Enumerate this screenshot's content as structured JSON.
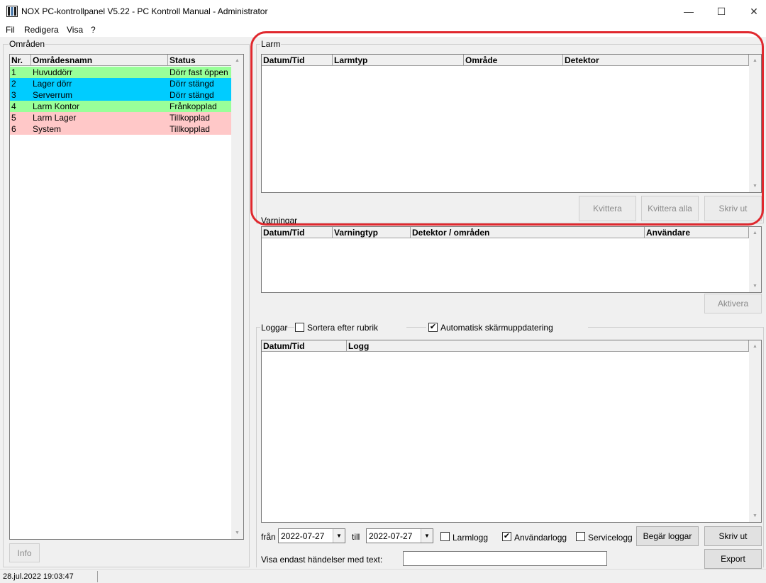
{
  "window": {
    "title": "NOX PC-kontrollpanel V5.22 - PC Kontroll Manual - Administrator",
    "minimize": "—",
    "maximize": "☐",
    "close": "✕"
  },
  "menu": [
    "Fil",
    "Redigera",
    "Visa",
    "?"
  ],
  "areas": {
    "label": "Områden",
    "columns": [
      "Nr.",
      "Områdesnamn",
      "Status"
    ],
    "rows": [
      {
        "nr": "1",
        "name": "Huvuddörr",
        "status": "Dörr fast öppen",
        "color": "#99ff99"
      },
      {
        "nr": "2",
        "name": "Lager dörr",
        "status": "Dörr stängd",
        "color": "#00ccff"
      },
      {
        "nr": "3",
        "name": "Serverrum",
        "status": "Dörr stängd",
        "color": "#00ccff"
      },
      {
        "nr": "4",
        "name": "Larm Kontor",
        "status": "Frånkopplad",
        "color": "#99ff99"
      },
      {
        "nr": "5",
        "name": "Larm Lager",
        "status": "Tillkopplad",
        "color": "#ffc8c8"
      },
      {
        "nr": "6",
        "name": "System",
        "status": "Tillkopplad",
        "color": "#ffc8c8"
      }
    ],
    "info_button": "Info"
  },
  "alarms": {
    "label": "Larm",
    "columns": [
      "Datum/Tid",
      "Larmtyp",
      "Område",
      "Detektor"
    ],
    "buttons": {
      "acknowledge": "Kvittera",
      "acknowledge_all": "Kvittera alla",
      "print": "Skriv ut"
    }
  },
  "warnings": {
    "label": "Varningar",
    "columns": [
      "Datum/Tid",
      "Varningtyp",
      "Detektor / områden",
      "Användare"
    ],
    "activate_button": "Aktivera"
  },
  "logs": {
    "label": "Loggar",
    "sort_label": "Sortera efter rubrik",
    "sort_checked": false,
    "auto_update_label": "Automatisk skärmuppdatering",
    "auto_update_checked": true,
    "check_mark": "✔",
    "columns": [
      "Datum/Tid",
      "Logg"
    ],
    "from_label": "från",
    "from_date": "2022-07-27",
    "to_label": "till",
    "to_date": "2022-07-27",
    "alarm_log_label": "Larmlogg",
    "alarm_log_checked": false,
    "user_log_label": "Användarlogg",
    "user_log_checked": true,
    "service_log_label": "Servicelogg",
    "service_log_checked": false,
    "request_button": "Begär loggar",
    "print_button": "Skriv ut",
    "export_button": "Export",
    "filter_label": "Visa endast händelser med text:",
    "filter_value": ""
  },
  "status": {
    "datetime": "28.jul.2022  19:03:47"
  },
  "icons": {
    "scroll_up": "▲",
    "scroll_down": "▼",
    "dropdown": "▼"
  }
}
